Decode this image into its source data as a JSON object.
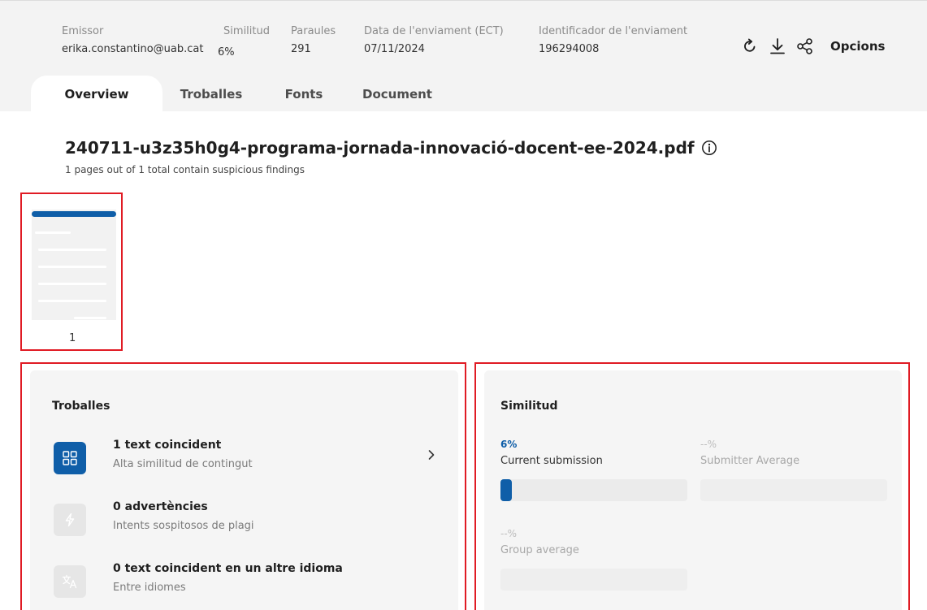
{
  "header": {
    "emissor": {
      "label": "Emissor",
      "value": "erika.constantino@uab.cat"
    },
    "similitud": {
      "label": "Similitud",
      "value": "6%"
    },
    "paraules": {
      "label": "Paraules",
      "value": "291"
    },
    "data": {
      "label": "Data de l'enviament (ECT)",
      "value": "07/11/2024"
    },
    "identificador": {
      "label": "Identificador de l'enviament",
      "value": "196294008"
    },
    "options_label": "Opcions",
    "icons": [
      "refresh-icon",
      "download-icon",
      "share-icon"
    ]
  },
  "tabs": [
    {
      "label": "Overview",
      "active": true
    },
    {
      "label": "Troballes",
      "active": false
    },
    {
      "label": "Fonts",
      "active": false
    },
    {
      "label": "Document",
      "active": false
    }
  ],
  "document": {
    "title": "240711-u3z35h0g4-programa-jornada-innovació-docent-ee-2024.pdf",
    "subtitle": "1 pages out of 1 total contain suspicious findings",
    "page_number": "1"
  },
  "findings": {
    "title": "Troballes",
    "items": [
      {
        "title": "1 text coincident",
        "desc": "Alta similitud de contingut",
        "icon": "grid-icon",
        "active": true
      },
      {
        "title": "0 advertències",
        "desc": "Intents sospitosos de plagi",
        "icon": "lightning-icon",
        "active": false
      },
      {
        "title": "0 text coincident en un altre idioma",
        "desc": "Entre idiomes",
        "icon": "translate-icon",
        "active": false
      }
    ]
  },
  "similarity": {
    "title": "Similitud",
    "current": {
      "value": "6%",
      "label": "Current submission",
      "fraction": 0.06
    },
    "submitter": {
      "value": "--%",
      "label": "Submitter Average",
      "fraction": 0
    },
    "group": {
      "value": "--%",
      "label": "Group average",
      "fraction": 0
    }
  },
  "colors": {
    "accent": "#0f5ea8",
    "highlight_border": "#e01b24",
    "header_bg": "#f3f3f3",
    "panel_bg": "#f5f5f5",
    "inactive_icon_bg": "#e6e6e6"
  }
}
